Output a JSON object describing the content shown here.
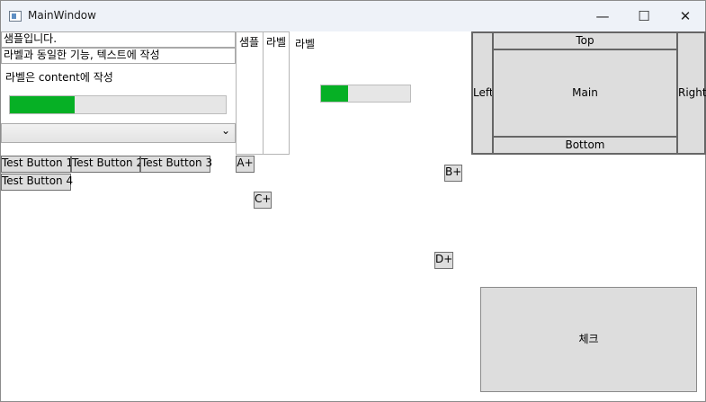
{
  "window": {
    "title": "MainWindow",
    "minimize": "—",
    "maximize": "☐",
    "close": "✕"
  },
  "left_panel": {
    "textbox1": "샘플입니다.",
    "textbox2": "라벨과 동일한 기능, 텍스트에 작성",
    "label_content": "라벨은 content에 작성",
    "progress_value": 0.3,
    "combo_value": "",
    "combo_arrow": "⌄"
  },
  "buttons": [
    "Test Button 1",
    "Test Button 2",
    "Test Button 3",
    "Test Button 4"
  ],
  "vertical_boxes": {
    "sample": "샘플",
    "label": "라벨"
  },
  "canvas": {
    "label": "라벨",
    "progress_value": 0.3,
    "btn_a": "A+",
    "btn_b": "B+",
    "btn_c": "C+",
    "btn_d": "D+"
  },
  "dock": {
    "top": "Top",
    "left": "Left",
    "main": "Main",
    "right": "Right",
    "bottom": "Bottom"
  },
  "check_button": "체크"
}
